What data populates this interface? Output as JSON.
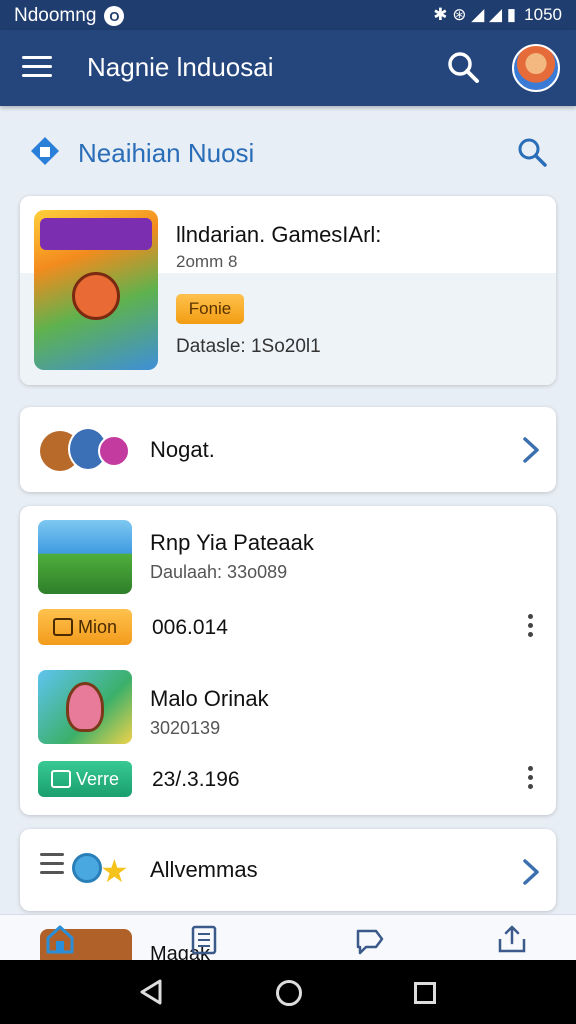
{
  "status_bar": {
    "app_name": "Ndoomng",
    "notif_glyph": "O",
    "icons": "✱ ⊛ ◢ ◢ ▮",
    "time": "1050"
  },
  "app_bar": {
    "title": "Nagnie lnduosai"
  },
  "section": {
    "title": "Neaihian Nuosi"
  },
  "featured": {
    "title": "llndarian. GamesIArl:",
    "subtitle": "2omm 8",
    "badge": "Fonie",
    "date_line": "Datasle: 1So20l1"
  },
  "nogat_row": {
    "label": "Nogat."
  },
  "list": {
    "items": [
      {
        "title": "Rnp Yia Pateaak",
        "subtitle": "Daulaah: 33o089",
        "pill_label": "Mion",
        "value": "006.014"
      },
      {
        "title": "Malo Orinak",
        "subtitle": "3020139",
        "pill_label": "Verre",
        "value": "23/.3.196"
      }
    ]
  },
  "all_row": {
    "label": "Allvemmas"
  },
  "bottom_nav": {
    "label": "Magak"
  },
  "colors": {
    "app_bar": "#25467d",
    "status_bar": "#1f3d6e",
    "accent": "#2a6db8",
    "orange": "#f29d12",
    "green": "#1a9f6e"
  },
  "icons": [
    "menu-icon",
    "search-icon",
    "avatar",
    "home-diamond-icon",
    "chevron-right-icon",
    "kebab-icon",
    "home-icon",
    "document-icon",
    "chat-icon",
    "share-icon",
    "back-icon",
    "home-circle-icon",
    "recents-icon"
  ]
}
